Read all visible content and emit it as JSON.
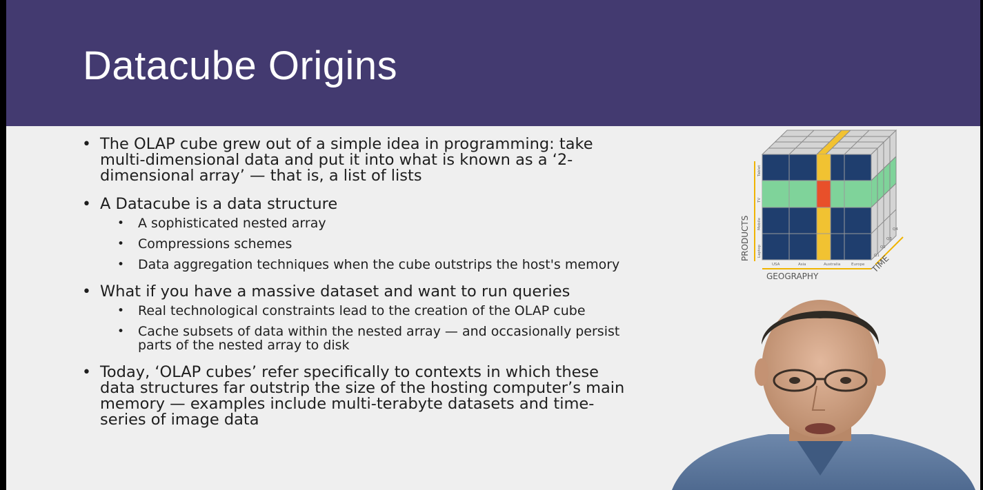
{
  "slide": {
    "title": "Datacube Origins",
    "bullets": [
      {
        "text": "The OLAP cube grew out of a simple idea in programming: take multi-dimensional data and put it into what is known as a ‘2-dimensional array’ — that is, a list of lists",
        "sub": []
      },
      {
        "text": "A Datacube is a data structure",
        "sub": [
          "A sophisticated nested array",
          "Compressions schemes",
          "Data aggregation techniques when the cube outstrips the host's memory"
        ]
      },
      {
        "text": "What if you have a massive dataset and want to run queries",
        "sub": [
          "Real technological constraints lead to the creation of the OLAP cube",
          "Cache subsets of data within the nested array — and occasionally persist parts of the nested array to disk"
        ]
      },
      {
        "text": "Today, ‘OLAP cubes’ refer specifically to contexts in which these data structures far outstrip the size of the hosting computer’s main memory — examples include multi-terabyte datasets and time-series of image data",
        "sub": []
      }
    ]
  },
  "figure": {
    "axis_products": "PRODUCTS",
    "axis_geography": "GEOGRAPHY",
    "axis_time": "TIME",
    "products": [
      "Laptop",
      "Mobile",
      "TV",
      "Tablet"
    ],
    "geography": [
      "USA",
      "Asia",
      "Australia",
      "Europe"
    ],
    "time": [
      "Q1",
      "Q2",
      "Q3",
      "Q4"
    ],
    "colors": {
      "navy": "#1f3e6e",
      "yellow": "#f1c232",
      "green": "#7fd39a",
      "red": "#e8502a",
      "grey": "#d4d4d4",
      "axis": "#f0b400"
    }
  },
  "colors": {
    "title_band": "#433a70",
    "slide_bg": "#efefef"
  }
}
